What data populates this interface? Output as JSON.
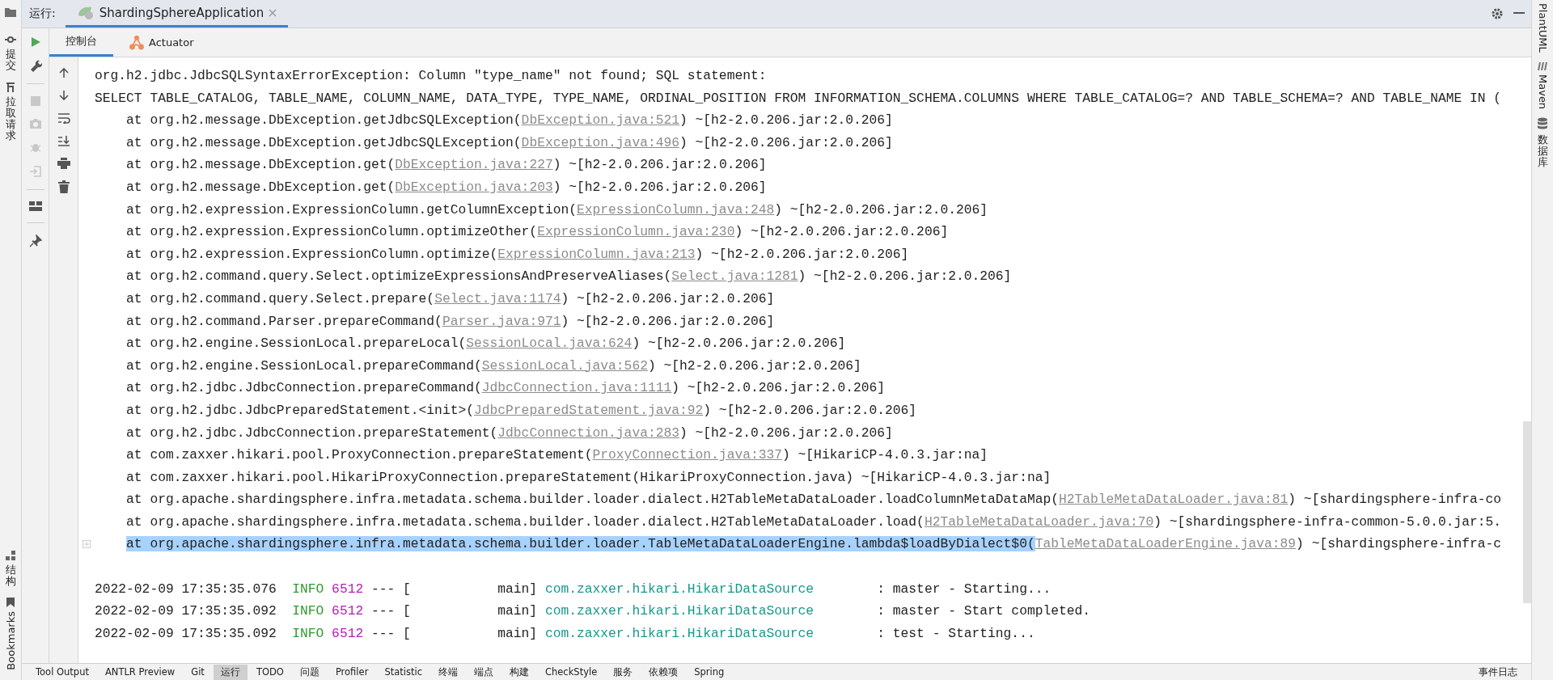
{
  "run_bar": {
    "label": "运行:",
    "tab": {
      "title": "ShardingSphereApplication",
      "selected": true
    }
  },
  "left_strip": {
    "top": [
      {
        "label": "提交",
        "kind": "commit"
      },
      {
        "label": "拉取请求",
        "kind": "pull"
      }
    ],
    "bottom": [
      {
        "label": "结构",
        "kind": "structure"
      },
      {
        "label": "Bookmarks",
        "kind": "bookmark"
      }
    ]
  },
  "right_strip": [
    {
      "label": "PlantUML",
      "kind": "plantuml"
    },
    {
      "label": "Maven",
      "kind": "maven"
    },
    {
      "label": "数据库",
      "kind": "database"
    }
  ],
  "sub_tabs": [
    {
      "label": "控制台",
      "selected": true
    },
    {
      "label": "Actuator",
      "selected": false
    }
  ],
  "console": [
    {
      "kind": "text",
      "text": "org.h2.jdbc.JdbcSQLSyntaxErrorException: Column \"type_name\" not found; SQL statement:"
    },
    {
      "kind": "text",
      "text": "SELECT TABLE_CATALOG, TABLE_NAME, COLUMN_NAME, DATA_TYPE, TYPE_NAME, ORDINAL_POSITION FROM INFORMATION_SCHEMA.COLUMNS WHERE TABLE_CATALOG=? AND TABLE_SCHEMA=? AND TABLE_NAME IN ("
    },
    {
      "kind": "trace",
      "text": "at org.h2.message.DbException.getJdbcSQLException(",
      "link": "DbException.java:521",
      "tail": ") ~[h2-2.0.206.jar:2.0.206]",
      "selected": false
    },
    {
      "kind": "trace",
      "text": "at org.h2.message.DbException.getJdbcSQLException(",
      "link": "DbException.java:496",
      "tail": ") ~[h2-2.0.206.jar:2.0.206]",
      "selected": false
    },
    {
      "kind": "trace",
      "text": "at org.h2.message.DbException.get(",
      "link": "DbException.java:227",
      "tail": ") ~[h2-2.0.206.jar:2.0.206]",
      "selected": false
    },
    {
      "kind": "trace",
      "text": "at org.h2.message.DbException.get(",
      "link": "DbException.java:203",
      "tail": ") ~[h2-2.0.206.jar:2.0.206]",
      "selected": false
    },
    {
      "kind": "trace",
      "text": "at org.h2.expression.ExpressionColumn.getColumnException(",
      "link": "ExpressionColumn.java:248",
      "tail": ") ~[h2-2.0.206.jar:2.0.206]",
      "selected": false
    },
    {
      "kind": "trace",
      "text": "at org.h2.expression.ExpressionColumn.optimizeOther(",
      "link": "ExpressionColumn.java:230",
      "tail": ") ~[h2-2.0.206.jar:2.0.206]",
      "selected": false
    },
    {
      "kind": "trace",
      "text": "at org.h2.expression.ExpressionColumn.optimize(",
      "link": "ExpressionColumn.java:213",
      "tail": ") ~[h2-2.0.206.jar:2.0.206]",
      "selected": false
    },
    {
      "kind": "trace",
      "text": "at org.h2.command.query.Select.optimizeExpressionsAndPreserveAliases(",
      "link": "Select.java:1281",
      "tail": ") ~[h2-2.0.206.jar:2.0.206]",
      "selected": false
    },
    {
      "kind": "trace",
      "text": "at org.h2.command.query.Select.prepare(",
      "link": "Select.java:1174",
      "tail": ") ~[h2-2.0.206.jar:2.0.206]",
      "selected": false
    },
    {
      "kind": "trace",
      "text": "at org.h2.command.Parser.prepareCommand(",
      "link": "Parser.java:971",
      "tail": ") ~[h2-2.0.206.jar:2.0.206]",
      "selected": false
    },
    {
      "kind": "trace",
      "text": "at org.h2.engine.SessionLocal.prepareLocal(",
      "link": "SessionLocal.java:624",
      "tail": ") ~[h2-2.0.206.jar:2.0.206]",
      "selected": false
    },
    {
      "kind": "trace",
      "text": "at org.h2.engine.SessionLocal.prepareCommand(",
      "link": "SessionLocal.java:562",
      "tail": ") ~[h2-2.0.206.jar:2.0.206]",
      "selected": false
    },
    {
      "kind": "trace",
      "text": "at org.h2.jdbc.JdbcConnection.prepareCommand(",
      "link": "JdbcConnection.java:1111",
      "tail": ") ~[h2-2.0.206.jar:2.0.206]",
      "selected": false
    },
    {
      "kind": "trace",
      "text": "at org.h2.jdbc.JdbcPreparedStatement.<init>(",
      "link": "JdbcPreparedStatement.java:92",
      "tail": ") ~[h2-2.0.206.jar:2.0.206]",
      "selected": false
    },
    {
      "kind": "trace",
      "text": "at org.h2.jdbc.JdbcConnection.prepareStatement(",
      "link": "JdbcConnection.java:283",
      "tail": ") ~[h2-2.0.206.jar:2.0.206]",
      "selected": false
    },
    {
      "kind": "trace",
      "text": "at com.zaxxer.hikari.pool.ProxyConnection.prepareStatement(",
      "link": "ProxyConnection.java:337",
      "tail": ") ~[HikariCP-4.0.3.jar:na]",
      "selected": false
    },
    {
      "kind": "trace",
      "text": "at com.zaxxer.hikari.pool.HikariProxyConnection.prepareStatement(HikariProxyConnection.java) ~[HikariCP-4.0.3.jar:na]",
      "selected": false
    },
    {
      "kind": "trace",
      "text": "at org.apache.shardingsphere.infra.metadata.schema.builder.loader.dialect.H2TableMetaDataLoader.loadColumnMetaDataMap(",
      "link": "H2TableMetaDataLoader.java:81",
      "tail": ") ~[shardingsphere-infra-co",
      "selected": false
    },
    {
      "kind": "trace",
      "text": "at org.apache.shardingsphere.infra.metadata.schema.builder.loader.dialect.H2TableMetaDataLoader.load(",
      "link": "H2TableMetaDataLoader.java:70",
      "tail": ") ~[shardingsphere-infra-common-5.0.0.jar:5.",
      "selected": false
    },
    {
      "kind": "trace",
      "text": "at org.apache.shardingsphere.infra.metadata.schema.builder.loader.TableMetaDataLoaderEngine.lambda$loadByDialect$0(",
      "link": "TableMetaDataLoaderEngine.java:89",
      "tail": ") ~[shardingsphere-infra-c",
      "selected": true,
      "folded": true
    },
    {
      "kind": "blank"
    },
    {
      "kind": "log",
      "time": "2022-02-09 17:35:35.076",
      "level": "INFO",
      "pid": "6512",
      "sep": "---",
      "thread": "[           main]",
      "logger": "com.zaxxer.hikari.HikariDataSource",
      "message": ": master - Starting..."
    },
    {
      "kind": "log",
      "time": "2022-02-09 17:35:35.092",
      "level": "INFO",
      "pid": "6512",
      "sep": "---",
      "thread": "[           main]",
      "logger": "com.zaxxer.hikari.HikariDataSource",
      "message": ": master - Start completed."
    },
    {
      "kind": "log",
      "time": "2022-02-09 17:35:35.092",
      "level": "INFO",
      "pid": "6512",
      "sep": "---",
      "thread": "[           main]",
      "logger": "com.zaxxer.hikari.HikariDataSource",
      "message": ": test - Starting..."
    }
  ],
  "bottom_bar": {
    "tools": [
      {
        "label": "Tool Output",
        "selected": false
      },
      {
        "label": "ANTLR Preview",
        "selected": false
      },
      {
        "label": "Git",
        "selected": false
      },
      {
        "label": "运行",
        "selected": true
      },
      {
        "label": "TODO",
        "selected": false
      },
      {
        "label": "问题",
        "selected": false
      },
      {
        "label": "Profiler",
        "selected": false
      },
      {
        "label": "Statistic",
        "selected": false
      },
      {
        "label": "终端",
        "selected": false
      },
      {
        "label": "端点",
        "selected": false
      },
      {
        "label": "构建",
        "selected": false
      },
      {
        "label": "CheckStyle",
        "selected": false
      },
      {
        "label": "服务",
        "selected": false
      },
      {
        "label": "依赖项",
        "selected": false
      },
      {
        "label": "Spring",
        "selected": false
      }
    ],
    "event_log": "事件日志"
  }
}
